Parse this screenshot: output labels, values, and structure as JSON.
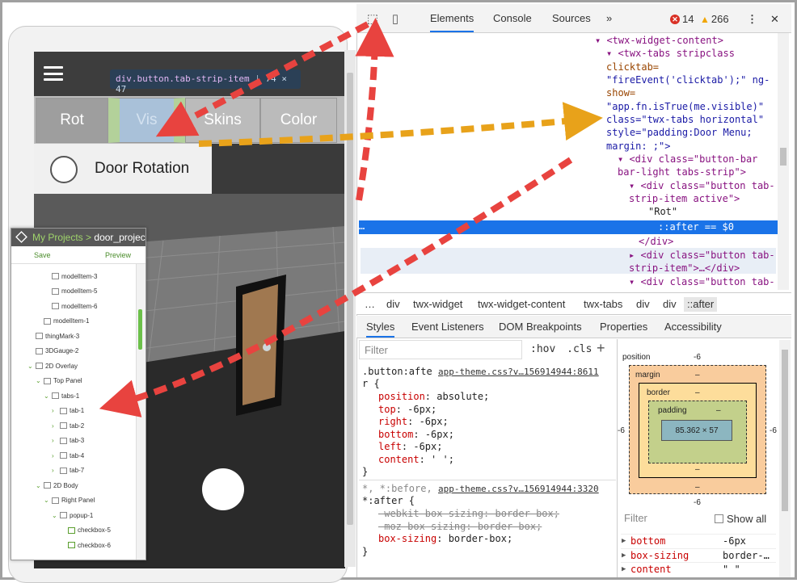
{
  "preview": {
    "tooltip_selector": "div.button.tab-strip-item",
    "tooltip_size": "74 × 47",
    "tabs": [
      {
        "label": "Rot",
        "state": "active"
      },
      {
        "label": "Vis",
        "state": "inspected"
      },
      {
        "label": "Skins",
        "state": "normal"
      },
      {
        "label": "Color",
        "state": "normal"
      }
    ],
    "door_label": "Door Rotation"
  },
  "project_tree": {
    "breadcrumb_root": "My Projects",
    "breadcrumb_sep": ">",
    "breadcrumb_current": "door_project",
    "save_label": "Save",
    "preview_label": "Preview",
    "items": [
      {
        "label": "modelItem-3",
        "indent": 4,
        "caret": "",
        "icon": "model"
      },
      {
        "label": "modelItem-5",
        "indent": 4,
        "caret": "",
        "icon": "model"
      },
      {
        "label": "modelItem-6",
        "indent": 4,
        "caret": "",
        "icon": "model"
      },
      {
        "label": "modelItem-1",
        "indent": 3,
        "caret": "",
        "icon": "model"
      },
      {
        "label": "thingMark-3",
        "indent": 2,
        "caret": "",
        "icon": "mark"
      },
      {
        "label": "3DGauge-2",
        "indent": 2,
        "caret": "",
        "icon": "gauge"
      },
      {
        "label": "2D Overlay",
        "indent": 2,
        "caret": "v",
        "icon": "overlay"
      },
      {
        "label": "Top Panel",
        "indent": 3,
        "caret": "v",
        "icon": "panel"
      },
      {
        "label": "tabs-1",
        "indent": 4,
        "caret": "v",
        "icon": "panel"
      },
      {
        "label": "tab-1",
        "indent": 5,
        "caret": ">",
        "icon": "panel"
      },
      {
        "label": "tab-2",
        "indent": 5,
        "caret": ">",
        "icon": "panel"
      },
      {
        "label": "tab-3",
        "indent": 5,
        "caret": ">",
        "icon": "panel"
      },
      {
        "label": "tab-4",
        "indent": 5,
        "caret": ">",
        "icon": "panel"
      },
      {
        "label": "tab-7",
        "indent": 5,
        "caret": ">",
        "icon": "panel"
      },
      {
        "label": "2D Body",
        "indent": 3,
        "caret": "v",
        "icon": "overlay"
      },
      {
        "label": "Right Panel",
        "indent": 4,
        "caret": "v",
        "icon": "panel"
      },
      {
        "label": "popup-1",
        "indent": 5,
        "caret": "v",
        "icon": "panel"
      },
      {
        "label": "checkbox-5",
        "indent": 6,
        "caret": "",
        "icon": "check"
      },
      {
        "label": "checkbox-6",
        "indent": 6,
        "caret": "",
        "icon": "check"
      }
    ]
  },
  "devtools": {
    "tabs": [
      "Elements",
      "Console",
      "Sources"
    ],
    "more": "»",
    "error_count": "14",
    "warning_count": "266",
    "menu_icon": "⋮",
    "close_icon": "✕",
    "dom": {
      "l0": "<twx-widget-content>",
      "l1": "<twx-tabs stripclass",
      "l2": "clicktab=",
      "l3": "\"fireEvent('clicktab');\" ng-",
      "l4": "show=",
      "l5": "\"app.fn.isTrue(me.visible)\"",
      "l6": "class=\"twx-tabs  horizontal\"",
      "l7": "style=\"padding:Door Menu;",
      "l8": "margin: ;\">",
      "l9": "<div class=\"button-bar",
      "l10": "bar-light tabs-strip\">",
      "l11": "<div class=\"button tab-",
      "l12": "strip-item active\">",
      "l13": "\"Rot\"",
      "l14": "::after == $0",
      "l15": "</div>",
      "l16": "<div class=\"button tab-",
      "l17": "strip-item\">…</div>",
      "l18": "<div class=\"button tab-",
      "sel_dots": "…"
    },
    "breadcrumbs": [
      "…",
      "div",
      "twx-widget",
      "twx-widget-content",
      "twx-tabs",
      "div",
      "div",
      "::after"
    ],
    "subtabs": [
      "Styles",
      "Event Listeners",
      "DOM Breakpoints",
      "Properties",
      "Accessibility"
    ],
    "filter_placeholder": "Filter",
    "hov": ":hov",
    "cls": ".cls",
    "plus": "+",
    "rule1": {
      "selector_a": ".button:afte",
      "selector_b": "r {",
      "source": "app-theme.css?v…156914944:8611",
      "decls": [
        {
          "p": "position",
          "v": "absolute;"
        },
        {
          "p": "top",
          "v": "-6px;"
        },
        {
          "p": "right",
          "v": "-6px;"
        },
        {
          "p": "bottom",
          "v": "-6px;"
        },
        {
          "p": "left",
          "v": "-6px;"
        },
        {
          "p": "content",
          "v": "' ';"
        }
      ],
      "close": "}"
    },
    "rule2": {
      "selector_a": "*, *:before,",
      "selector_b": "*:after {",
      "source": "app-theme.css?v…156914944:3320",
      "decls": [
        {
          "p": "-webkit-box-sizing",
          "v": "border-box;",
          "struck": true
        },
        {
          "p": "-moz-box-sizing",
          "v": "border-box;",
          "struck": true
        },
        {
          "p": "box-sizing",
          "v": "border-box;",
          "struck": false
        }
      ],
      "close": "}"
    },
    "boxmodel": {
      "position_label": "position",
      "position_val": "-6",
      "margin_label": "margin",
      "border_label": "border",
      "padding_label": "padding",
      "dash": "–",
      "content_size": "85.362 × 57",
      "side_left": "-6",
      "side_right": "-6",
      "bottom_val": "-6"
    },
    "computed_filter": "Filter",
    "show_all": "Show all",
    "computed": [
      {
        "k": "bottom",
        "v": "-6px"
      },
      {
        "k": "box-sizing",
        "v": "border-…"
      },
      {
        "k": "content",
        "v": "\" \""
      }
    ]
  },
  "colors": {
    "accent": "#1a73e8",
    "arrow_red": "#e8433f",
    "arrow_orange": "#e8a21a"
  }
}
